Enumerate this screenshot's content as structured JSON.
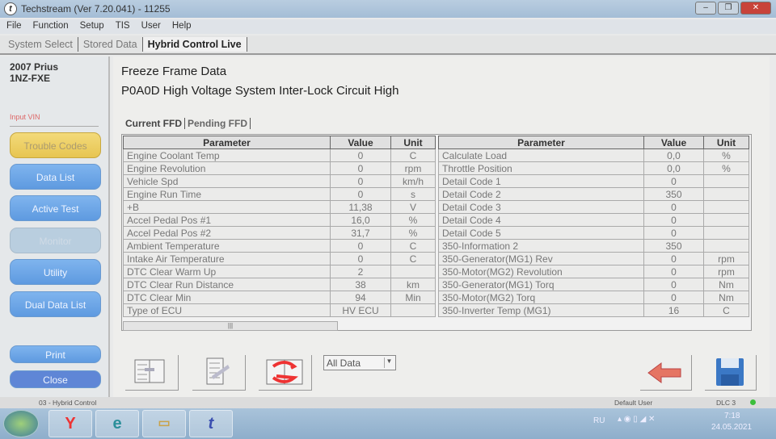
{
  "window": {
    "title": "Techstream (Ver 7.20.041) - 11255"
  },
  "menu": [
    "File",
    "Function",
    "Setup",
    "TIS",
    "User",
    "Help"
  ],
  "tabs": [
    "System Select",
    "Stored Data",
    "Hybrid Control Live"
  ],
  "vehicle": {
    "model": "2007 Prius",
    "engine": "1NZ-FXE",
    "input_vin": "Input VIN"
  },
  "sidebar": {
    "buttons": [
      "Trouble Codes",
      "Data List",
      "Active Test",
      "Monitor",
      "Utility",
      "Dual Data List"
    ],
    "print": "Print",
    "close": "Close"
  },
  "main": {
    "title": "Freeze Frame Data",
    "dtc": "P0A0D High Voltage System Inter-Lock Circuit High",
    "ffd_tabs": [
      "Current FFD",
      "Pending FFD"
    ]
  },
  "table_headers": [
    "Parameter",
    "Value",
    "Unit"
  ],
  "left_rows": [
    [
      "Engine Coolant Temp",
      "0",
      "C"
    ],
    [
      "Engine Revolution",
      "0",
      "rpm"
    ],
    [
      "Vehicle Spd",
      "0",
      "km/h"
    ],
    [
      "Engine Run Time",
      "0",
      "s"
    ],
    [
      "+B",
      "11,38",
      "V"
    ],
    [
      "Accel Pedal Pos #1",
      "16,0",
      "%"
    ],
    [
      "Accel Pedal Pos #2",
      "31,7",
      "%"
    ],
    [
      "Ambient Temperature",
      "0",
      "C"
    ],
    [
      "Intake Air Temperature",
      "0",
      "C"
    ],
    [
      "DTC Clear Warm Up",
      "2",
      ""
    ],
    [
      "DTC Clear Run Distance",
      "38",
      "km"
    ],
    [
      "DTC Clear Min",
      "94",
      "Min"
    ],
    [
      "Type of ECU",
      "HV ECU",
      ""
    ]
  ],
  "right_rows": [
    [
      "Calculate Load",
      "0,0",
      "%"
    ],
    [
      "Throttle Position",
      "0,0",
      "%"
    ],
    [
      "Detail Code 1",
      "0",
      ""
    ],
    [
      "Detail Code 2",
      "350",
      ""
    ],
    [
      "Detail Code 3",
      "0",
      ""
    ],
    [
      "Detail Code 4",
      "0",
      ""
    ],
    [
      "Detail Code 5",
      "0",
      ""
    ],
    [
      "350-Information 2",
      "350",
      ""
    ],
    [
      "350-Generator(MG1) Rev",
      "0",
      "rpm"
    ],
    [
      "350-Motor(MG2) Revolution",
      "0",
      "rpm"
    ],
    [
      "350-Generator(MG1) Torq",
      "0",
      "Nm"
    ],
    [
      "350-Motor(MG2) Torq",
      "0",
      "Nm"
    ],
    [
      "350-Inverter Temp (MG1)",
      "16",
      "C"
    ]
  ],
  "toolbar": {
    "filter_selected": "All Data"
  },
  "status": {
    "system": "03 - Hybrid Control",
    "user": "Default User",
    "connection": "DLC 3",
    "connection_color": "#3cbf3c"
  },
  "taskbar": {
    "lang": "RU",
    "time": "7:18",
    "date": "24.05.2021"
  }
}
